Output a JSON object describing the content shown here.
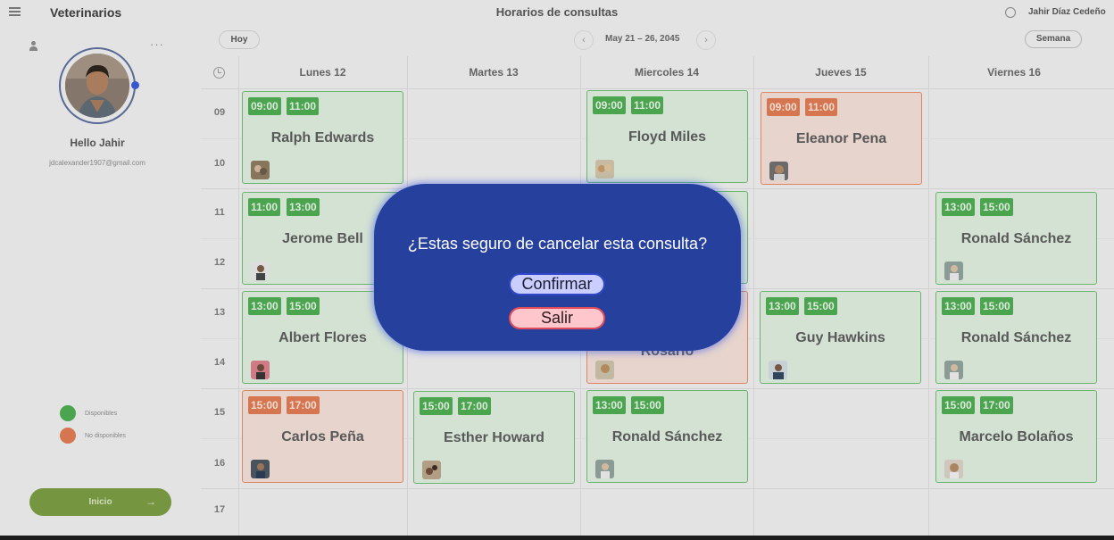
{
  "header": {
    "app_title": "Veterinarios",
    "page_title": "Horarios de consultas",
    "user_name": "Jahir Díaz Cedeño"
  },
  "sidebar": {
    "greeting": "Hello Jahir",
    "email": "jdcalexander1907@gmail.com",
    "more_glyph": "···",
    "legend": [
      {
        "label": "Disponibles",
        "color": "#4caa50"
      },
      {
        "label": "No disponibles",
        "color": "#de7a52"
      }
    ],
    "home_button": "Inicio",
    "home_arrow": "→"
  },
  "toolbar": {
    "today": "Hoy",
    "prev": "‹",
    "next": "›",
    "range": "May 21 – 26, 2045",
    "view": "Semana"
  },
  "calendar": {
    "days": [
      "Lunes 12",
      "Martes 13",
      "Miercoles 14",
      "Jueves 15",
      "Viernes 16"
    ],
    "hours": [
      "09",
      "10",
      "11",
      "12",
      "13",
      "14",
      "15",
      "16",
      "17"
    ],
    "appointments": [
      {
        "name": "Ralph Edwards",
        "start": "09:00",
        "end": "11:00",
        "status": "available"
      },
      {
        "name": "Floyd Miles",
        "start": "09:00",
        "end": "11:00",
        "status": "available"
      },
      {
        "name": "Eleanor Pena",
        "start": "09:00",
        "end": "11:00",
        "status": "unavailable"
      },
      {
        "name": "Jerome Bell",
        "start": "11:00",
        "end": "13:00",
        "status": "available"
      },
      {
        "name": "Ronald Sánchez",
        "start": "13:00",
        "end": "15:00",
        "status": "available"
      },
      {
        "name": "Albert Flores",
        "start": "13:00",
        "end": "15:00",
        "status": "available"
      },
      {
        "name": "Guy Hawkins",
        "start": "13:00",
        "end": "15:00",
        "status": "available"
      },
      {
        "name": "Ronald Sánchez",
        "start": "13:00",
        "end": "15:00",
        "status": "available"
      },
      {
        "name": "Carlos Peña",
        "start": "15:00",
        "end": "17:00",
        "status": "unavailable"
      },
      {
        "name": "Esther Howard",
        "start": "15:00",
        "end": "17:00",
        "status": "available"
      },
      {
        "name": "Ronald Sánchez",
        "start": "13:00",
        "end": "15:00",
        "status": "available"
      },
      {
        "name": "Marcelo Bolaños",
        "start": "15:00",
        "end": "17:00",
        "status": "available"
      },
      {
        "name": "Rosario",
        "status": "unavailable"
      }
    ]
  },
  "modal": {
    "question": "¿Estas seguro de cancelar esta consulta?",
    "confirm": "Confirmar",
    "exit": "Salir"
  },
  "colors": {
    "available": "#4caa50",
    "unavailable": "#de7a52",
    "modal_bg": "#26409e",
    "home_button": "#7a9a42"
  }
}
